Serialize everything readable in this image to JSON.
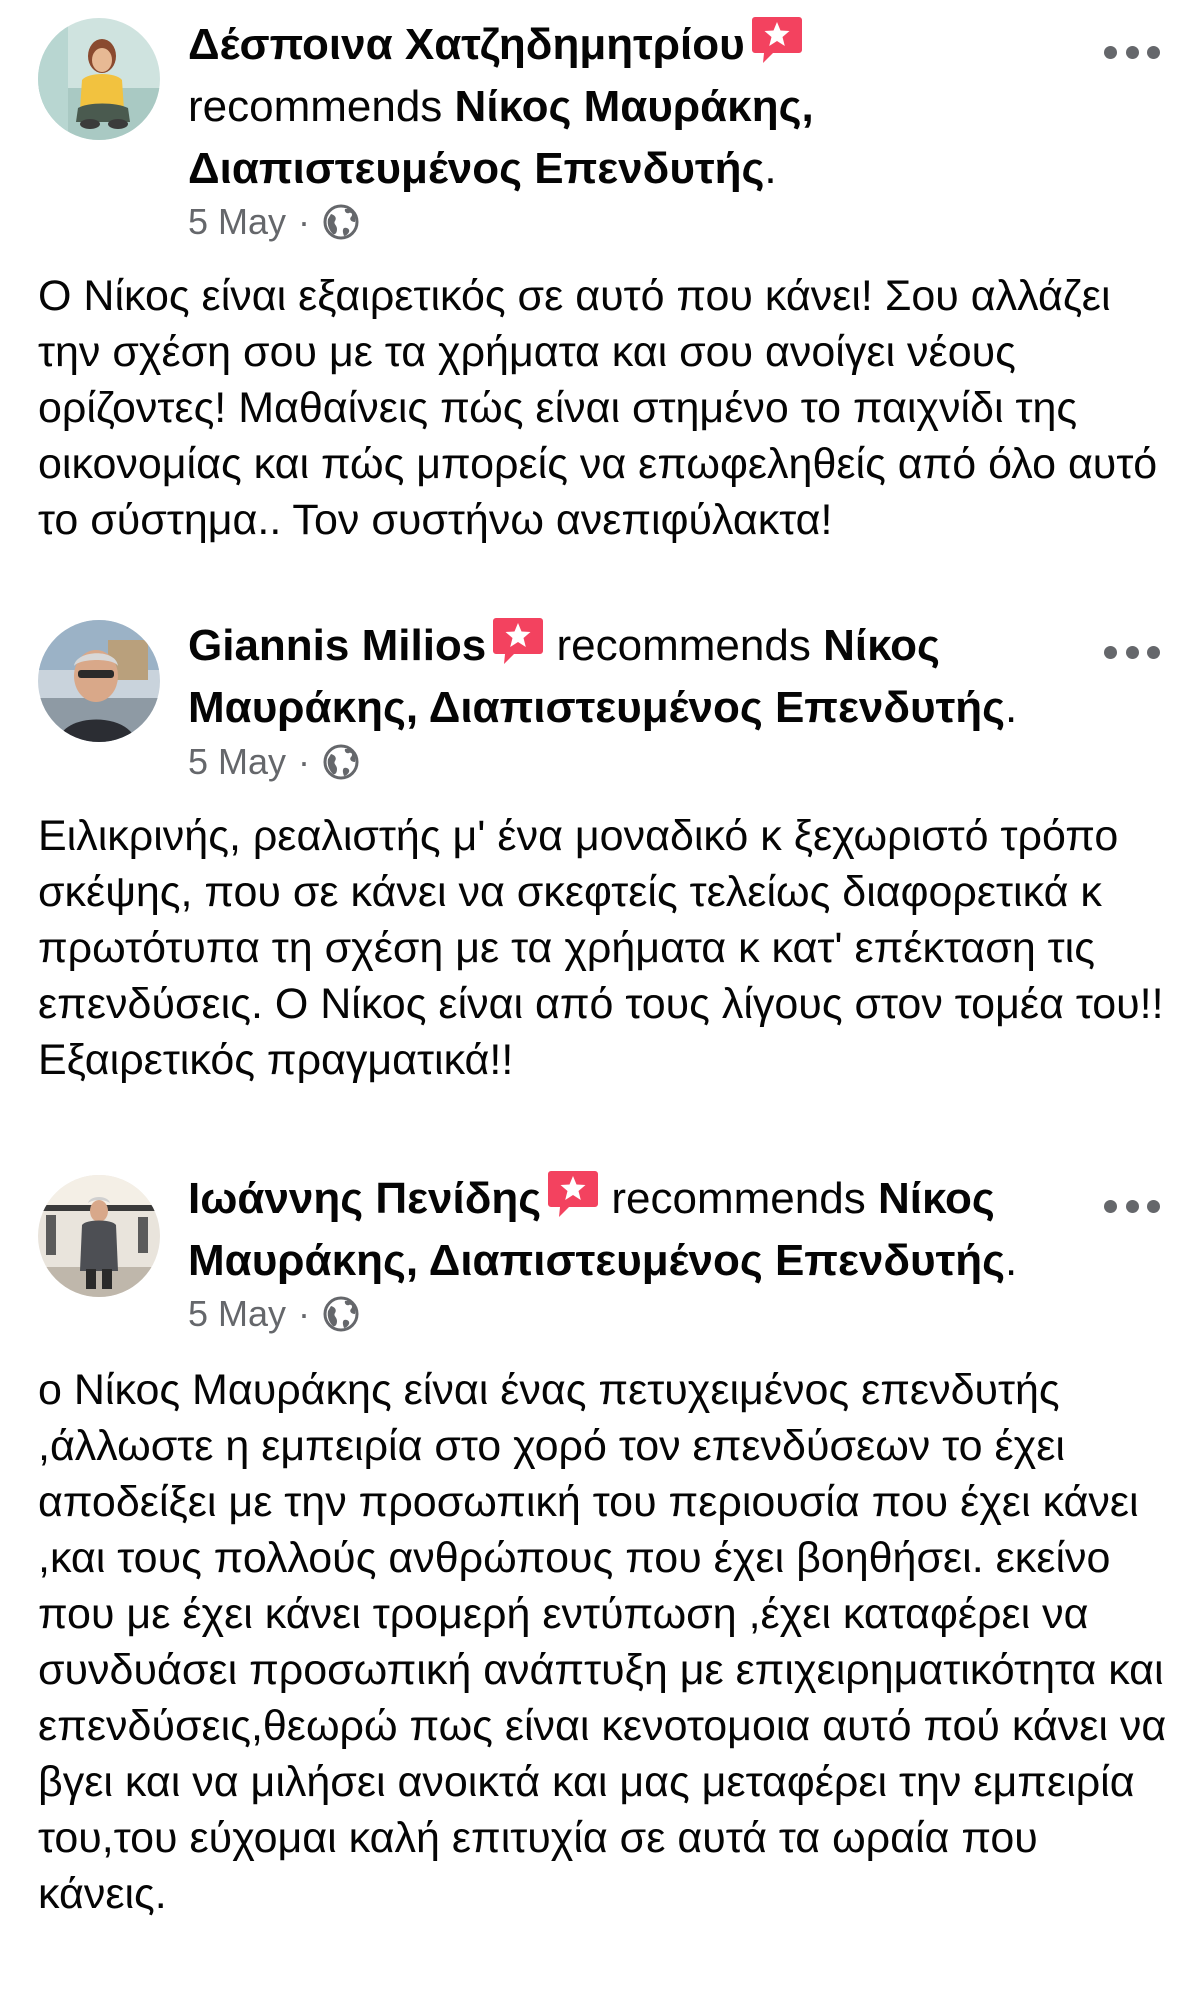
{
  "posts": [
    {
      "author": "Δέσποινα Χατζηδημητρίου",
      "recommends_text": "recommends",
      "page_name": "Νίκος Μαυράκης, Διαπιστευμένος Επενδυτής",
      "period": ".",
      "date": "5 May",
      "separator": "·",
      "icon": "globe-icon",
      "text": "Ο Νίκος είναι εξαιρετικός σε αυτό που κάνει! Σου αλλάζει την σχέση σου με τα χρήματα και σου ανοίγει νέους ορίζοντες! Μαθαίνεις πώς είναι στημένο το παιχνίδι της οικονομίας και πώς μπορείς να επωφεληθείς από όλο αυτό το σύστημα.. Τον συστήνω ανεπιφύλακτα!"
    },
    {
      "author": "Giannis Milios",
      "recommends_text": "recommends",
      "page_name": "Νίκος Μαυράκης, Διαπιστευμένος Επενδυτής",
      "period": ".",
      "date": "5 May",
      "separator": "·",
      "icon": "globe-icon",
      "text": "Ειλικρινής, ρεαλιστής μ' ένα μοναδικό κ ξεχωριστό τρόπο σκέψης, που σε κάνει να σκεφτείς τελείως διαφορετικά κ πρωτότυπα τη σχέση με τα χρήματα κ κατ' επέκταση τις επενδύσεις. Ο Νίκος είναι από τους λίγους στον τομέα του!! Εξαιρετικός πραγματικά!!"
    },
    {
      "author": "Ιωάννης Πενίδης",
      "recommends_text": "recommends",
      "page_name": "Νίκος Μαυράκης, Διαπιστευμένος Επενδυτής",
      "period": ".",
      "date": "5 May",
      "separator": "·",
      "icon": "globe-icon",
      "text": "ο Νίκος Μαυράκης είναι ένας πετυχειμένος επενδυτής ,άλλωστε η εμπειρία στο χορό τον επενδύσεων το έχει αποδείξει με την προσωπική του περιουσία που έχει κάνει ,και τους πολλούς ανθρώπους που έχει βοηθήσει. εκείνο που με έχει κάνει τρομερή εντύπωση ,έχει καταφέρει να συνδυάσει προσωπική ανάπτυξη με επιχειρηματικότητα και επενδύσεις,θεωρώ πως είναι κενοτομοια αυτό πού  κάνει να βγει και να μιλήσει ανοικτά και  μας μεταφέρει την εμπειρία του,του εύχομαι καλή επιτυχία σε αυτά τα ωραία που κάνεις."
    }
  ],
  "colors": {
    "text": "#050505",
    "secondary": "#65676b",
    "badge": "#f3425f"
  },
  "icons": {
    "recommendation_badge": "star-badge-icon",
    "more": "more-options-icon",
    "audience": "globe-icon"
  }
}
